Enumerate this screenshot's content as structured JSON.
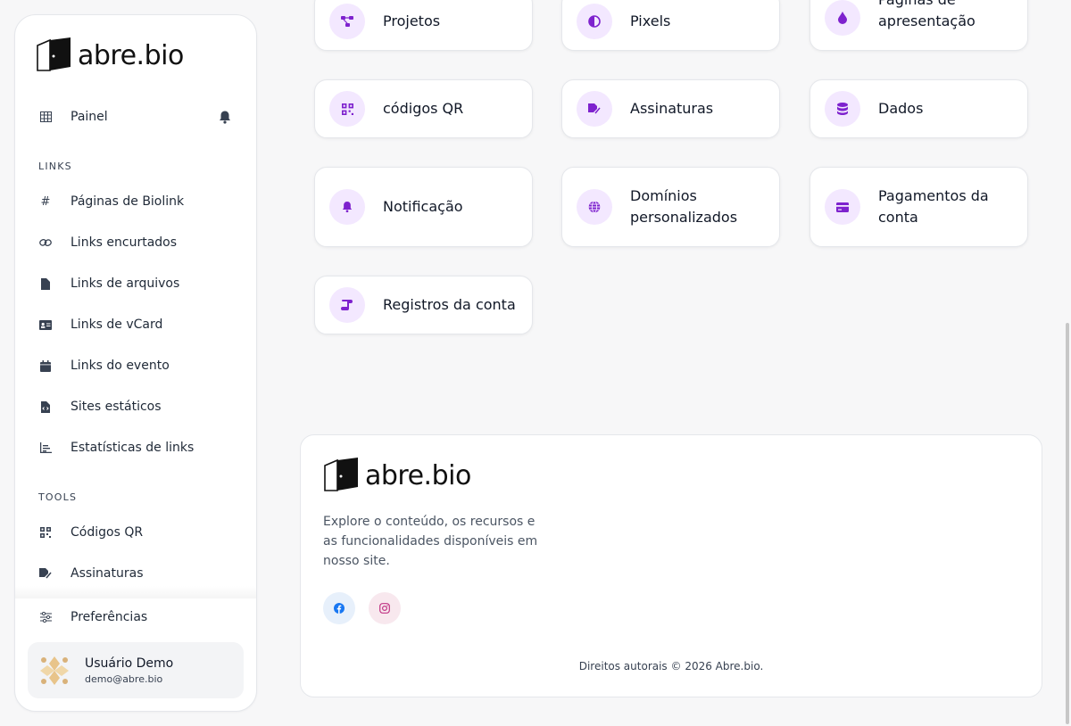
{
  "brand": {
    "name": "abre.bio"
  },
  "sidebar": {
    "dashboard": "Painel",
    "links_section": "LINKS",
    "links": [
      {
        "label": "Páginas de Biolink",
        "icon": "hash-icon"
      },
      {
        "label": "Links encurtados",
        "icon": "link-icon"
      },
      {
        "label": "Links de arquivos",
        "icon": "file-icon"
      },
      {
        "label": "Links de vCard",
        "icon": "vcard-icon"
      },
      {
        "label": "Links do evento",
        "icon": "calendar-icon"
      },
      {
        "label": "Sites estáticos",
        "icon": "file-code-icon"
      },
      {
        "label": "Estatísticas de links",
        "icon": "chart-icon"
      }
    ],
    "tools_section": "TOOLS",
    "tools": [
      {
        "label": "Códigos QR",
        "icon": "qr-icon"
      },
      {
        "label": "Assinaturas",
        "icon": "signature-icon"
      }
    ],
    "preferences": "Preferências",
    "user": {
      "name": "Usuário Demo",
      "email": "demo@abre.bio"
    }
  },
  "cards": [
    {
      "label": "Projetos",
      "icon": "project-diagram-icon"
    },
    {
      "label": "Pixels",
      "icon": "adjust-icon"
    },
    {
      "label": "Páginas de apresentação",
      "icon": "droplet-icon"
    },
    {
      "label": "códigos QR",
      "icon": "qr-icon"
    },
    {
      "label": "Assinaturas",
      "icon": "signature-icon"
    },
    {
      "label": "Dados",
      "icon": "database-icon"
    },
    {
      "label": "Notificação",
      "icon": "bell-icon"
    },
    {
      "label": "Domínios personalizados",
      "icon": "globe-icon"
    },
    {
      "label": "Pagamentos da conta",
      "icon": "credit-card-icon"
    },
    {
      "label": "Registros da conta",
      "icon": "scroll-icon"
    }
  ],
  "footer": {
    "description": "Explore o conteúdo, os recursos e as funcionalidades disponíveis em nosso site.",
    "copyright": "Direitos autorais © 2026 Abre.bio.",
    "social": [
      {
        "icon": "facebook-icon",
        "color": "#1877f2",
        "bg": "#e7f0fb"
      },
      {
        "icon": "instagram-icon",
        "color": "#c13584",
        "bg": "#f8e8ee"
      }
    ]
  },
  "colors": {
    "accent": "#7e22ce",
    "accent_bg": "#f3e8ff"
  }
}
